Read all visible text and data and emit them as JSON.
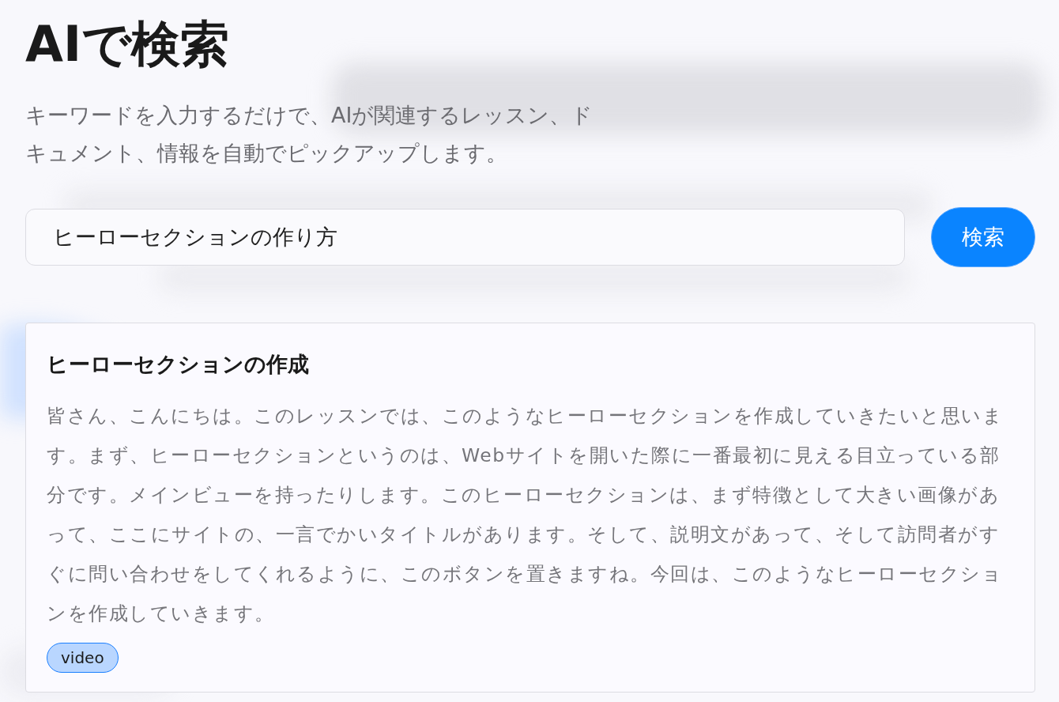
{
  "title": "AIで検索",
  "description": "キーワードを入力するだけで、AIが関連するレッスン、ドキュメント、情報を自動でピックアップします。",
  "search": {
    "value": "ヒーローセクションの作り方",
    "button": "検索"
  },
  "results": [
    {
      "title": "ヒーローセクションの作成",
      "snippet": "皆さん、こんにちは。このレッスンでは、このようなヒーローセクションを作成していきたいと思います。まず、ヒーローセクションというのは、Webサイトを開いた際に一番最初に見える目立っている部分です。メインビューを持ったりします。このヒーローセクションは、まず特徴として大きい画像があって、ここにサイトの、一言でかいタイトルがあります。そして、説明文があって、そして訪問者がすぐに問い合わせをしてくれるように、このボタンを置きますね。今回は、このようなヒーローセクションを作成していきます。",
      "tags": [
        "video"
      ]
    }
  ]
}
